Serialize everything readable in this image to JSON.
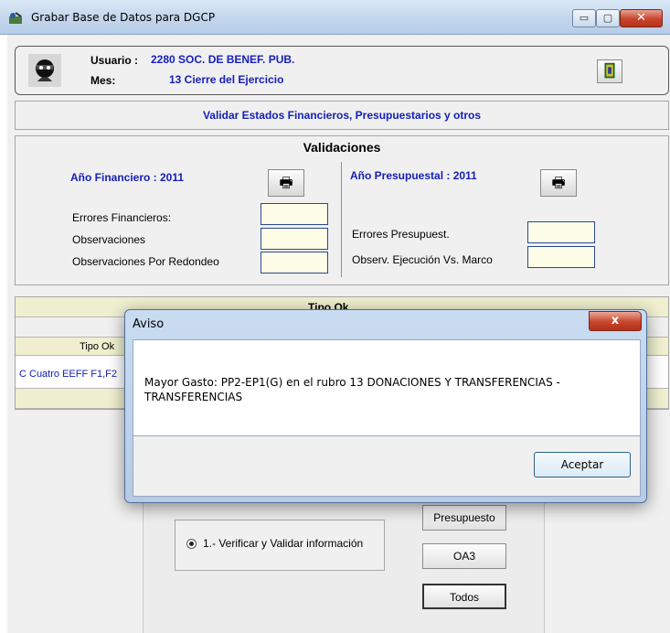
{
  "window": {
    "title": "Grabar  Base de Datos para DGCP",
    "min_glyph": "▭",
    "max_glyph": "▢",
    "close_glyph": "✕"
  },
  "user_panel": {
    "usuario_label": "Usuario :",
    "usuario_value": "2280 SOC. DE BENEF. PUB.",
    "mes_label": "Mes:",
    "mes_value": "13 Cierre del Ejercicio"
  },
  "section_title": "Validar Estados Financieros, Presupuestarios y otros",
  "validaciones": {
    "title": "Validaciones",
    "financiero": {
      "heading": "Año Financiero   : 2011",
      "rows": [
        "Errores Financieros:",
        "Observaciones",
        "Observaciones Por Redondeo"
      ]
    },
    "presupuestal": {
      "heading": "Año Presupuestal : 2011",
      "rows": [
        "Errores Presupuest.",
        "Observ. Ejecución Vs. Marco"
      ]
    },
    "print_glyph": "🖶"
  },
  "grid": {
    "header_top": "Tipo Ok",
    "col_header": "Tipo Ok",
    "row1": "C Cuatro EEFF F1,F2"
  },
  "lower": {
    "radio_label": "1.- Verificar y Validar información",
    "buttons": [
      "Presupuesto",
      "OA3",
      "Todos"
    ]
  },
  "dialog": {
    "title": "Aviso",
    "close_glyph": "x",
    "message": "Mayor Gasto: PP2-EP1(G) en el rubro 13 DONACIONES Y TRANSFERENCIAS - TRANSFERENCIAS",
    "accept_label": "Aceptar"
  },
  "colors": {
    "accent_blue": "#1520b8",
    "field_bg": "#fdfde8"
  },
  "icons": [
    "app-icon",
    "avatar-icon",
    "exit-door-icon",
    "printer-icon",
    "minimize-icon",
    "maximize-icon",
    "close-icon"
  ]
}
